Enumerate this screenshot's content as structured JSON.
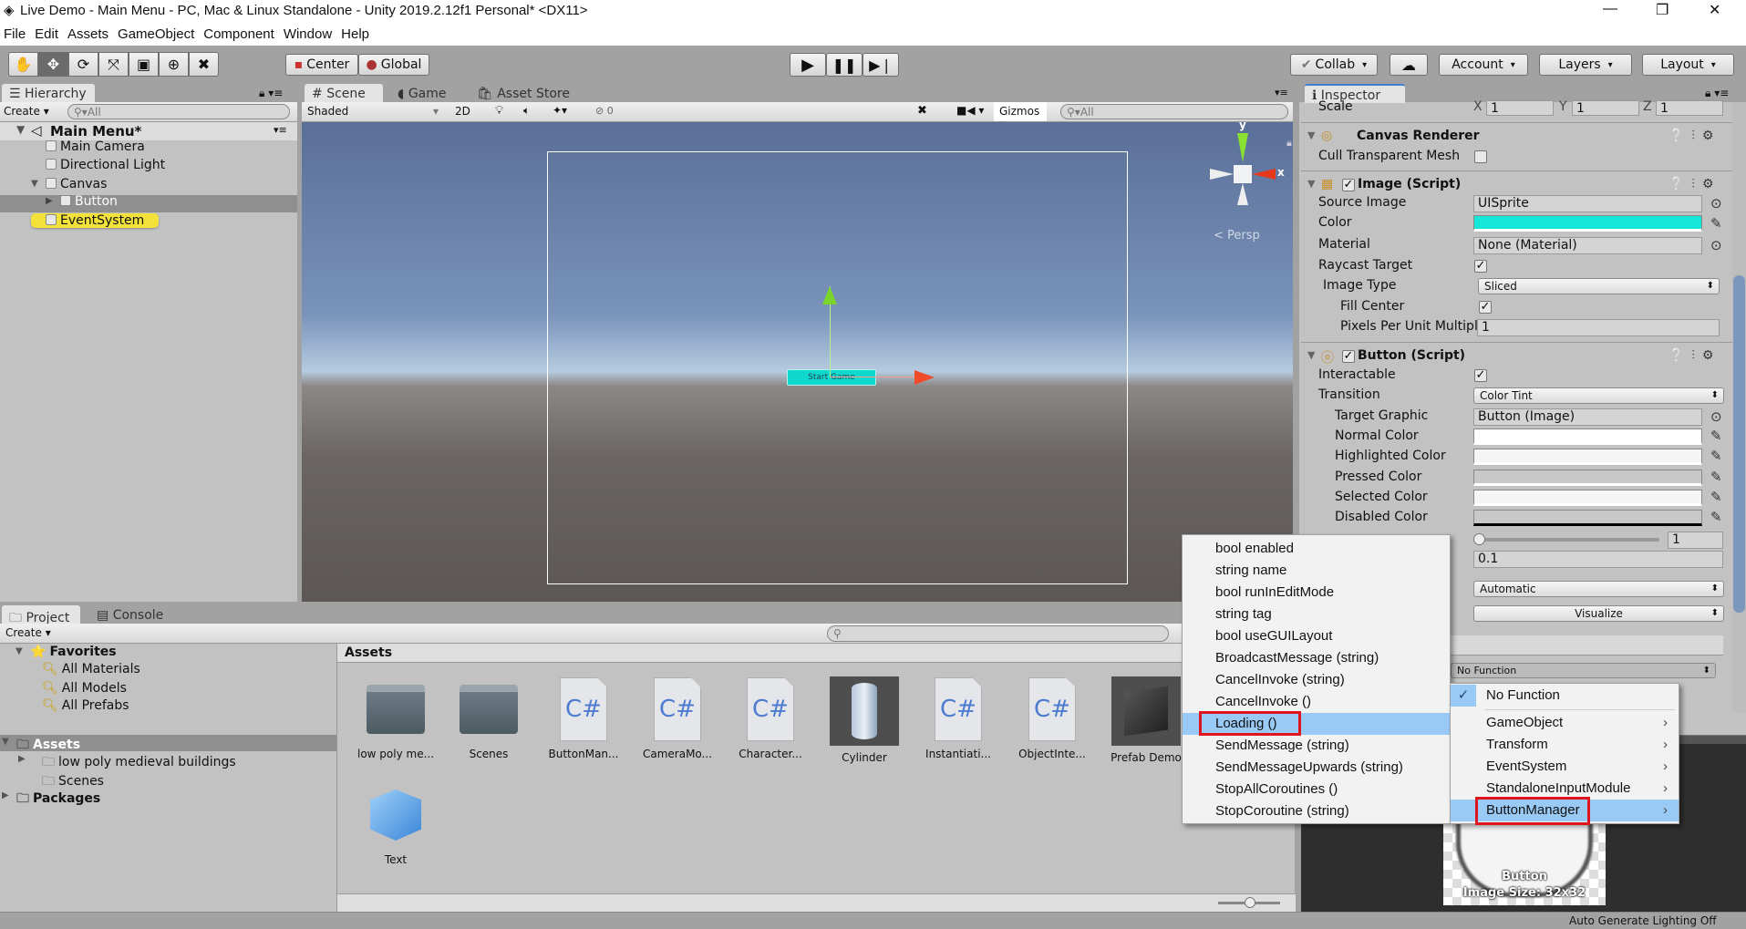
{
  "window": {
    "title": "Live Demo - Main Menu - PC, Mac & Linux Standalone - Unity 2019.2.12f1 Personal* <DX11>",
    "controls": [
      "—",
      "❐",
      "✕"
    ]
  },
  "menubar": [
    "File",
    "Edit",
    "Assets",
    "GameObject",
    "Component",
    "Window",
    "Help"
  ],
  "toolbar": {
    "tools": [
      "hand-tool",
      "move-tool",
      "rotate-tool",
      "scale-tool",
      "rect-tool",
      "transform-tool",
      "custom-tool"
    ],
    "pivot": "Center",
    "space": "Global",
    "collab": "Collab",
    "account": "Account",
    "layers": "Layers",
    "layout": "Layout"
  },
  "hierarchy": {
    "tab": "Hierarchy",
    "create": "Create",
    "search_placeholder": "All",
    "scene": "Main Menu*",
    "items": [
      {
        "label": "Main Camera"
      },
      {
        "label": "Directional Light"
      },
      {
        "label": "Canvas"
      },
      {
        "label": "Button",
        "selected": true
      },
      {
        "label": "EventSystem",
        "highlighted": true
      }
    ]
  },
  "scene": {
    "tabs": [
      "Scene",
      "Game",
      "Asset Store"
    ],
    "shading": "Shaded",
    "mode2d": "2D",
    "hidden_count": "0",
    "gizmos": "Gizmos",
    "search_placeholder": "All",
    "persp": "Persp",
    "axis_x": "x",
    "axis_y": "y",
    "button_text": "Start Game"
  },
  "inspector": {
    "tab": "Inspector",
    "scale": {
      "label": "Scale",
      "x": "1",
      "y": "1",
      "z": "1"
    },
    "canvas_renderer": {
      "title": "Canvas Renderer",
      "cull_label": "Cull Transparent Mesh",
      "cull": false
    },
    "image": {
      "title": "Image (Script)",
      "source_image_label": "Source Image",
      "source_image": "UISprite",
      "color_label": "Color",
      "color": "#14e6d8",
      "material_label": "Material",
      "material": "None (Material)",
      "raycast_label": "Raycast Target",
      "raycast": true,
      "image_type_label": "Image Type",
      "image_type": "Sliced",
      "fill_center_label": "Fill Center",
      "fill_center": true,
      "ppu_label": "Pixels Per Unit Multipli",
      "ppu": "1"
    },
    "button": {
      "title": "Button (Script)",
      "interactable_label": "Interactable",
      "interactable": true,
      "transition_label": "Transition",
      "transition": "Color Tint",
      "target_graphic_label": "Target Graphic",
      "target_graphic": "Button (Image)",
      "normal_label": "Normal Color",
      "highlighted_label": "Highlighted Color",
      "pressed_label": "Pressed Color",
      "selected_label": "Selected Color",
      "disabled_label": "Disabled Color",
      "color_multiplier": "1",
      "fade_duration": "0.1",
      "navigation": "Automatic",
      "visualize": "Visualize",
      "onclick_function": "No Function"
    }
  },
  "context_menu_left": {
    "items": [
      "bool enabled",
      "string name",
      "bool runInEditMode",
      "string tag",
      "bool useGUILayout",
      "BroadcastMessage (string)",
      "CancelInvoke (string)",
      "CancelInvoke ()",
      "Loading ()",
      "SendMessage (string)",
      "SendMessageUpwards (string)",
      "StopAllCoroutines ()",
      "StopCoroutine (string)"
    ],
    "highlighted": "Loading ()"
  },
  "context_menu_right": {
    "items": [
      {
        "label": "No Function",
        "checked": true
      },
      {
        "label": "GameObject",
        "submenu": true
      },
      {
        "label": "Transform",
        "submenu": true
      },
      {
        "label": "EventSystem",
        "submenu": true
      },
      {
        "label": "StandaloneInputModule",
        "submenu": true
      },
      {
        "label": "ButtonManager",
        "submenu": true
      }
    ],
    "highlighted": "ButtonManager"
  },
  "project": {
    "tabs": [
      "Project",
      "Console"
    ],
    "create": "Create",
    "tree": [
      {
        "label": "Favorites",
        "bold": true
      },
      {
        "label": "All Materials"
      },
      {
        "label": "All Models"
      },
      {
        "label": "All Prefabs"
      },
      {
        "label": "Assets",
        "bold": true,
        "selected": true
      },
      {
        "label": "low poly medieval buildings"
      },
      {
        "label": "Scenes"
      },
      {
        "label": "Packages",
        "bold": true
      }
    ],
    "breadcrumb": "Assets",
    "assets": [
      {
        "label": "low poly me...",
        "kind": "folder"
      },
      {
        "label": "Scenes",
        "kind": "folder"
      },
      {
        "label": "ButtonMan...",
        "kind": "script"
      },
      {
        "label": "CameraMo...",
        "kind": "script"
      },
      {
        "label": "Character...",
        "kind": "script"
      },
      {
        "label": "Cylinder",
        "kind": "model"
      },
      {
        "label": "Instantiati...",
        "kind": "script"
      },
      {
        "label": "ObjectInte...",
        "kind": "script"
      },
      {
        "label": "Prefab Demo",
        "kind": "prefab"
      },
      {
        "label": "Text",
        "kind": "prefab-blue"
      }
    ],
    "script_glyph": "C#"
  },
  "preview": {
    "name": "Button",
    "size": "Image Size: 32x32"
  },
  "status": {
    "text": "Auto Generate Lighting Off"
  }
}
